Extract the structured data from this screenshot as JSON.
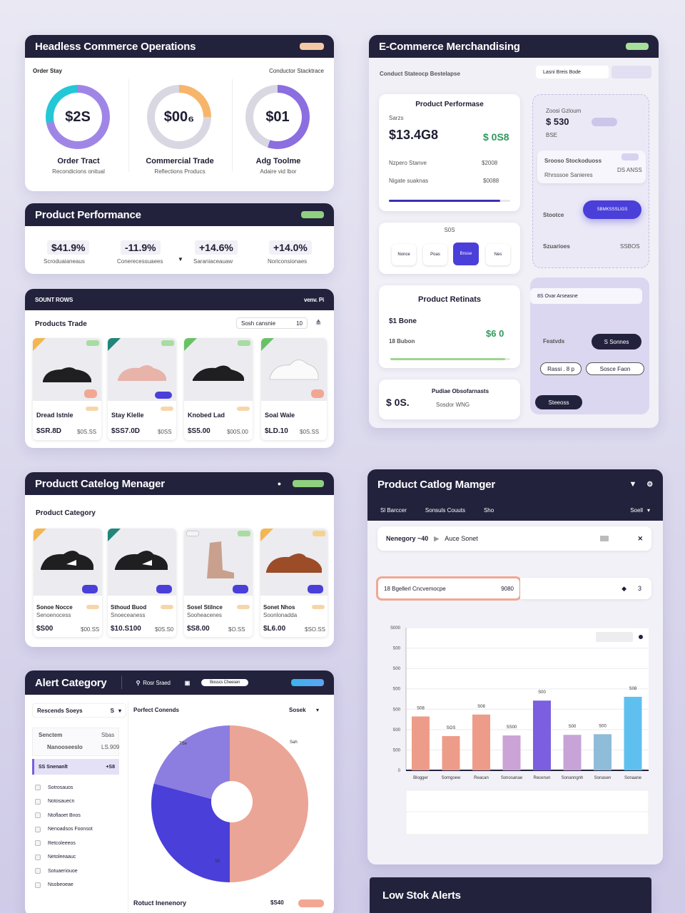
{
  "ops": {
    "title": "Headless Commerce Operations",
    "left_label": "Order Stay",
    "right_label": "Conductor Stacktrace",
    "donuts": [
      {
        "value": "$2S",
        "label": "Order Tract",
        "sub": "Recondicions onitual",
        "pct": 0.72,
        "accent": "#9f86e6",
        "accent2": "#24c7d6"
      },
      {
        "value": "$00₆",
        "label": "Commercial Trade",
        "sub": "Reflections Producs",
        "pct": 0.25,
        "accent": "#f6b56b",
        "accent2": "#d9d8e2"
      },
      {
        "value": "$01",
        "label": "Adg Toolme",
        "sub": "Adaire vid lbor",
        "pct": 0.55,
        "accent": "#8b6ee0",
        "accent2": "#d9d8e2"
      }
    ]
  },
  "perf": {
    "title": "Product Performance",
    "kpis": [
      {
        "value": "$41.9%",
        "sub": "Scroduaianeaus"
      },
      {
        "value": "-11.9%",
        "sub": "Conerecessuaees"
      },
      {
        "value": "+14.6%",
        "sub": "Saraniaceauaw"
      },
      {
        "value": "+14.0%",
        "sub": "Noriconsionaes"
      }
    ]
  },
  "trends": {
    "header": "SOUNT ROWS",
    "header_right": "venv. Pi",
    "title": "Products Trade",
    "search": "Sosh cansnie",
    "search_num": "10",
    "items": [
      {
        "name": "Dread Istnle",
        "price": "$SR.8D",
        "old": "$0S.SS",
        "corner": "#f3b652",
        "img": "#1f1f22"
      },
      {
        "name": "Stay Klelle",
        "price": "$SS7.0D",
        "old": "$0SS",
        "corner": "#21857a",
        "img": "#e8b3a9"
      },
      {
        "name": "Knobed Lad",
        "price": "$S5.00",
        "old": "$00S.00",
        "corner": "#69c167",
        "img": "#1f1f22"
      },
      {
        "name": "Soal Wale",
        "price": "$LD.10",
        "old": "$0S.SS",
        "corner": "#69c167",
        "img": "#f1f1f3"
      }
    ]
  },
  "merch": {
    "title": "E-Commerce Merchandising",
    "subtitle": "Conduct Stateocp Bestelapse",
    "search": "Lasni Breis Bode",
    "pp": {
      "title": "Product Performase",
      "k1": "$13.4G8",
      "k2": "$ 0S8",
      "lbl": "Sarzs",
      "r1": "Nzpero Stanve",
      "r1v": "$2008",
      "r2": "Nigate suaknas",
      "r2v": "$0088"
    },
    "pager": {
      "label": "S0S",
      "pages": [
        "Nonce",
        "Poas",
        "Bnsse",
        "Nes"
      ]
    },
    "pr": {
      "title": "Product Retinats",
      "k1": "$1 Bone",
      "k2": "$6 0",
      "r1": "18 Bubon"
    },
    "po": {
      "title": "Pudiae Obsofarnasts",
      "k1": "$ 0S.",
      "r1": "Sosdor WNG"
    },
    "right": {
      "section1": "Zoosi Gzloum",
      "value1": "$ 530",
      "small1": "BSE",
      "card": "Srooso Stockoduoss",
      "card_sub": "Rhrsssoe Sanieres",
      "card_sub2": "DS ANSS",
      "label2": "Stootce",
      "btn2": "SBMKSSSLIGS",
      "label3": "Szuarioes",
      "val3": "SSBOS",
      "filter": "8S Ovar Arseasne",
      "label4": "Featvds",
      "btn4": "S Sonnes",
      "chip1": "Rassi . 8 p",
      "chip2": "Sosce  Faon",
      "btn5": "Steeoss"
    }
  },
  "catalog": {
    "title": "Productt Catelog Menager",
    "subtitle": "Product Category",
    "items": [
      {
        "name": "Sonoe Nocce",
        "sub": "Senoenocess",
        "price": "$S00",
        "old": "$00.SS",
        "corner": "#f3b652",
        "img": "#1f1f22"
      },
      {
        "name": "Sthoud Buod",
        "sub": "Snoeceaness",
        "price": "$10.S100",
        "old": "$0S.S0",
        "corner": "#21857a",
        "img": "#1f1f22"
      },
      {
        "name": "Sosel Stilnce",
        "sub": "Sooheacenes",
        "price": "$S8.00",
        "old": "$O.SS",
        "corner": "#ffffff",
        "img": "#c9a08e"
      },
      {
        "name": "Sonet Nhos",
        "sub": "Soonlonadda",
        "price": "$L6.00",
        "old": "$SO.SS",
        "corner": "#f3b652",
        "img": "#9c4c26"
      }
    ]
  },
  "catmgr": {
    "title": "Product Catlog Mamger",
    "tabs": [
      "Sl Barccer",
      "Sonsuls Couuts",
      "Sho"
    ],
    "tab_right": "Soell",
    "search": "Nenegory ~40",
    "search2": "Auce Sonet",
    "filter": "18  Bgellerl Cncvemocpe",
    "filter_num": "9080",
    "filter_right": "3"
  },
  "chart_data": {
    "type": "bar",
    "title": "",
    "xlabel": "",
    "ylabel": "",
    "ylim": [
      0,
      450
    ],
    "y_ticks": [
      "0",
      "S00",
      "S00",
      "S00",
      "S00",
      "S00",
      "S00",
      "S000"
    ],
    "categories": [
      "Blogger",
      "Somgoew",
      "Reacan",
      "Sonosanae",
      "Recenun",
      "Sonanngnh",
      "Sonasen",
      "Sonaane"
    ],
    "values": [
      170,
      108,
      176,
      110,
      220,
      112,
      114,
      232
    ],
    "value_labels": [
      "S08",
      "SOS",
      "S08",
      "SS00",
      "S00",
      "S00",
      "S00",
      "S08"
    ],
    "colors": [
      "#ee9c8a",
      "#ee9c8a",
      "#ee9c8a",
      "#cba3d6",
      "#7b5fe0",
      "#c7a3d8",
      "#8fbcd8",
      "#5fc0ef"
    ],
    "grid": true,
    "legend": "none"
  },
  "alert": {
    "title": "Alert Category",
    "search": "Rosr Sraed",
    "toggle": "Bosscs Cheesen",
    "list_title": "Rescends Soeys",
    "list_num": "S",
    "rows": [
      {
        "l": "Senctem",
        "r": "Sbas"
      },
      {
        "l": "Nanooseeslo",
        "r": "LS.909"
      }
    ],
    "active": "SS  Snenanlt",
    "active_r": "+S8",
    "items": [
      "Sotrosauos",
      "Notosauecn",
      "Ntoflaoet Bnos",
      "Nenoadsos Foonsot",
      "Retcoleeeos",
      "Netoleeaauc",
      "Sotuaeriouoe",
      "Nsobeoeae"
    ],
    "pie_title": "Porfect Conends",
    "pie_right": "Sosek",
    "pie_labels": [
      "Sah",
      "S0",
      "TSe"
    ],
    "footer": "Rotuct  Inenenory",
    "footer_val": "$S40"
  },
  "lowstock": {
    "title": "Low Stok Alerts"
  }
}
